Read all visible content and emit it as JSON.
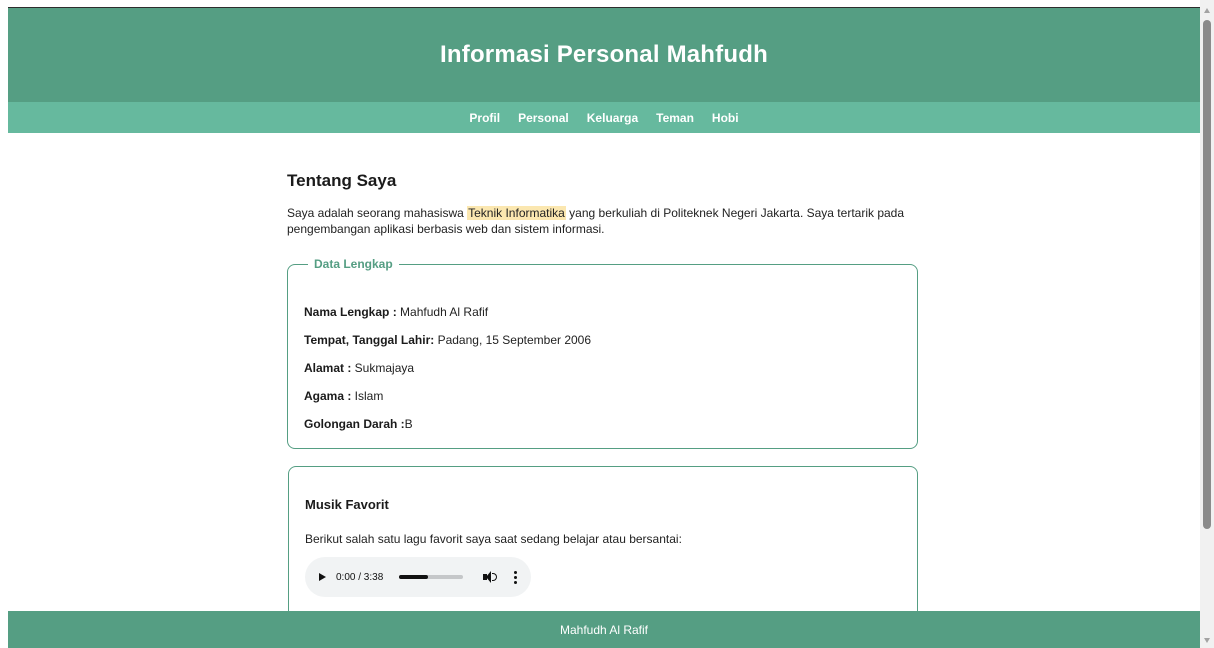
{
  "header": {
    "title": "Informasi Personal Mahfudh"
  },
  "nav": {
    "items": [
      {
        "label": "Profil"
      },
      {
        "label": "Personal"
      },
      {
        "label": "Keluarga"
      },
      {
        "label": "Teman"
      },
      {
        "label": "Hobi"
      }
    ]
  },
  "about": {
    "title": "Tentang Saya",
    "text_before": "Saya adalah seorang mahasiswa ",
    "highlight": "Teknik Informatika",
    "text_after": " yang berkuliah di Politeknek Negeri Jakarta. Saya tertarik pada pengembangan aplikasi berbasis web dan sistem informasi."
  },
  "data_lengkap": {
    "legend": "Data Lengkap",
    "rows": [
      {
        "label": "Nama Lengkap :",
        "value": " Mahfudh Al Rafif"
      },
      {
        "label": "Tempat, Tanggal Lahir:",
        "value": " Padang, 15 September 2006"
      },
      {
        "label": "Alamat :",
        "value": " Sukmajaya"
      },
      {
        "label": "Agama :",
        "value": " Islam"
      },
      {
        "label": "Golongan Darah :",
        "value": "B"
      }
    ]
  },
  "music": {
    "title": "Musik Favorit",
    "description": "Berikut salah satu lagu favorit saya saat sedang belajar atau bersantai:",
    "player": {
      "time": "0:00 / 3:38",
      "volume_fraction": 0.45
    }
  },
  "footer": {
    "text": "Mahfudh Al Rafif"
  },
  "colors": {
    "header_bg": "#559e83",
    "nav_bg": "#66b99e",
    "highlight_bg": "#fbe7b0",
    "accent": "#559e83"
  },
  "icons": {
    "play": "play-icon",
    "volume": "volume-icon",
    "more": "more-vertical-icon",
    "scroll_up": "chevron-up-icon",
    "scroll_down": "chevron-down-icon"
  }
}
